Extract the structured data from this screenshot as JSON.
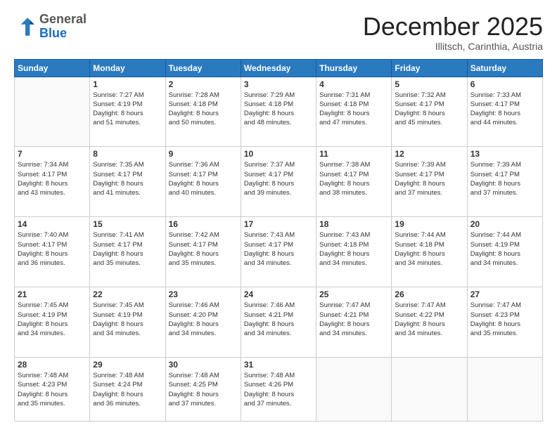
{
  "header": {
    "logo_general": "General",
    "logo_blue": "Blue",
    "month_title": "December 2025",
    "location": "Illitsch, Carinthia, Austria"
  },
  "days_of_week": [
    "Sunday",
    "Monday",
    "Tuesday",
    "Wednesday",
    "Thursday",
    "Friday",
    "Saturday"
  ],
  "weeks": [
    [
      {
        "day": "",
        "info": ""
      },
      {
        "day": "1",
        "info": "Sunrise: 7:27 AM\nSunset: 4:19 PM\nDaylight: 8 hours\nand 51 minutes."
      },
      {
        "day": "2",
        "info": "Sunrise: 7:28 AM\nSunset: 4:18 PM\nDaylight: 8 hours\nand 50 minutes."
      },
      {
        "day": "3",
        "info": "Sunrise: 7:29 AM\nSunset: 4:18 PM\nDaylight: 8 hours\nand 48 minutes."
      },
      {
        "day": "4",
        "info": "Sunrise: 7:31 AM\nSunset: 4:18 PM\nDaylight: 8 hours\nand 47 minutes."
      },
      {
        "day": "5",
        "info": "Sunrise: 7:32 AM\nSunset: 4:17 PM\nDaylight: 8 hours\nand 45 minutes."
      },
      {
        "day": "6",
        "info": "Sunrise: 7:33 AM\nSunset: 4:17 PM\nDaylight: 8 hours\nand 44 minutes."
      }
    ],
    [
      {
        "day": "7",
        "info": "Sunrise: 7:34 AM\nSunset: 4:17 PM\nDaylight: 8 hours\nand 43 minutes."
      },
      {
        "day": "8",
        "info": "Sunrise: 7:35 AM\nSunset: 4:17 PM\nDaylight: 8 hours\nand 41 minutes."
      },
      {
        "day": "9",
        "info": "Sunrise: 7:36 AM\nSunset: 4:17 PM\nDaylight: 8 hours\nand 40 minutes."
      },
      {
        "day": "10",
        "info": "Sunrise: 7:37 AM\nSunset: 4:17 PM\nDaylight: 8 hours\nand 39 minutes."
      },
      {
        "day": "11",
        "info": "Sunrise: 7:38 AM\nSunset: 4:17 PM\nDaylight: 8 hours\nand 38 minutes."
      },
      {
        "day": "12",
        "info": "Sunrise: 7:39 AM\nSunset: 4:17 PM\nDaylight: 8 hours\nand 37 minutes."
      },
      {
        "day": "13",
        "info": "Sunrise: 7:39 AM\nSunset: 4:17 PM\nDaylight: 8 hours\nand 37 minutes."
      }
    ],
    [
      {
        "day": "14",
        "info": "Sunrise: 7:40 AM\nSunset: 4:17 PM\nDaylight: 8 hours\nand 36 minutes."
      },
      {
        "day": "15",
        "info": "Sunrise: 7:41 AM\nSunset: 4:17 PM\nDaylight: 8 hours\nand 35 minutes."
      },
      {
        "day": "16",
        "info": "Sunrise: 7:42 AM\nSunset: 4:17 PM\nDaylight: 8 hours\nand 35 minutes."
      },
      {
        "day": "17",
        "info": "Sunrise: 7:43 AM\nSunset: 4:17 PM\nDaylight: 8 hours\nand 34 minutes."
      },
      {
        "day": "18",
        "info": "Sunrise: 7:43 AM\nSunset: 4:18 PM\nDaylight: 8 hours\nand 34 minutes."
      },
      {
        "day": "19",
        "info": "Sunrise: 7:44 AM\nSunset: 4:18 PM\nDaylight: 8 hours\nand 34 minutes."
      },
      {
        "day": "20",
        "info": "Sunrise: 7:44 AM\nSunset: 4:19 PM\nDaylight: 8 hours\nand 34 minutes."
      }
    ],
    [
      {
        "day": "21",
        "info": "Sunrise: 7:45 AM\nSunset: 4:19 PM\nDaylight: 8 hours\nand 34 minutes."
      },
      {
        "day": "22",
        "info": "Sunrise: 7:45 AM\nSunset: 4:19 PM\nDaylight: 8 hours\nand 34 minutes."
      },
      {
        "day": "23",
        "info": "Sunrise: 7:46 AM\nSunset: 4:20 PM\nDaylight: 8 hours\nand 34 minutes."
      },
      {
        "day": "24",
        "info": "Sunrise: 7:46 AM\nSunset: 4:21 PM\nDaylight: 8 hours\nand 34 minutes."
      },
      {
        "day": "25",
        "info": "Sunrise: 7:47 AM\nSunset: 4:21 PM\nDaylight: 8 hours\nand 34 minutes."
      },
      {
        "day": "26",
        "info": "Sunrise: 7:47 AM\nSunset: 4:22 PM\nDaylight: 8 hours\nand 34 minutes."
      },
      {
        "day": "27",
        "info": "Sunrise: 7:47 AM\nSunset: 4:23 PM\nDaylight: 8 hours\nand 35 minutes."
      }
    ],
    [
      {
        "day": "28",
        "info": "Sunrise: 7:48 AM\nSunset: 4:23 PM\nDaylight: 8 hours\nand 35 minutes."
      },
      {
        "day": "29",
        "info": "Sunrise: 7:48 AM\nSunset: 4:24 PM\nDaylight: 8 hours\nand 36 minutes."
      },
      {
        "day": "30",
        "info": "Sunrise: 7:48 AM\nSunset: 4:25 PM\nDaylight: 8 hours\nand 37 minutes."
      },
      {
        "day": "31",
        "info": "Sunrise: 7:48 AM\nSunset: 4:26 PM\nDaylight: 8 hours\nand 37 minutes."
      },
      {
        "day": "",
        "info": ""
      },
      {
        "day": "",
        "info": ""
      },
      {
        "day": "",
        "info": ""
      }
    ]
  ]
}
